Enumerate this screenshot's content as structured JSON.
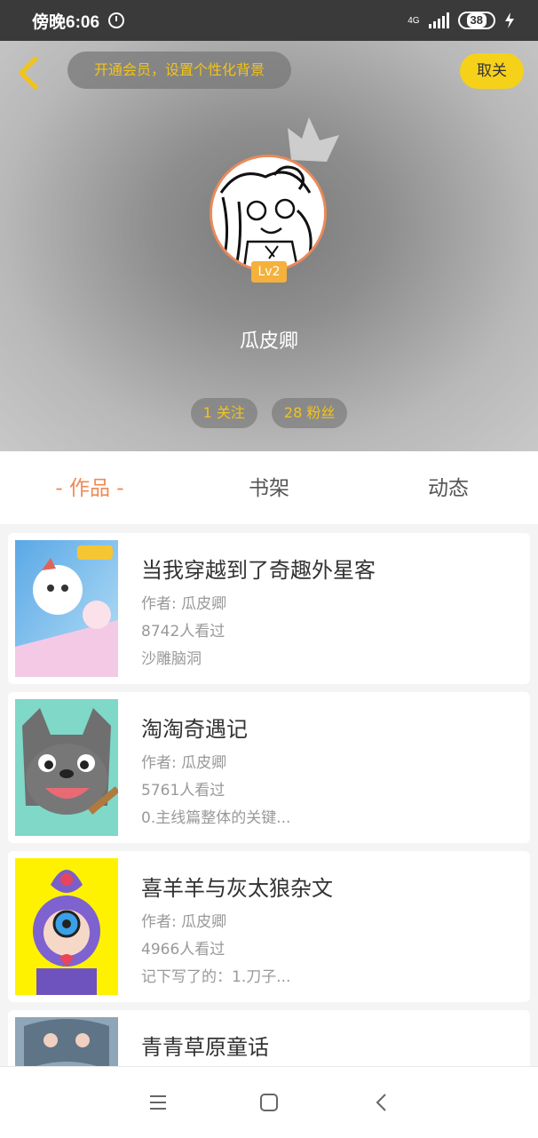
{
  "status_bar": {
    "time": "傍晚6:06",
    "network": "4G",
    "battery": "38"
  },
  "header": {
    "vip_prompt": "开通会员，设置个性化背景",
    "follow_button": "取关",
    "level_badge": "Lv2",
    "username": "瓜皮卿",
    "stats": {
      "following": "1 关注",
      "fans": "28 粉丝"
    }
  },
  "tabs": [
    {
      "label": "- 作品 -",
      "active": true
    },
    {
      "label": "书架",
      "active": false
    },
    {
      "label": "动态",
      "active": false
    }
  ],
  "works": [
    {
      "title": "当我穿越到了奇趣外星客",
      "author": "作者: 瓜皮卿",
      "views": "8742人看过",
      "desc": "沙雕脑洞"
    },
    {
      "title": "淘淘奇遇记",
      "author": "作者: 瓜皮卿",
      "views": "5761人看过",
      "desc": "0.主线篇整体的关键..."
    },
    {
      "title": "喜羊羊与灰太狼杂文",
      "author": "作者: 瓜皮卿",
      "views": "4966人看过",
      "desc": "记下写了的：1.刀子..."
    },
    {
      "title": "青青草原童话",
      "author": "",
      "views": "",
      "desc": ""
    }
  ],
  "colors": {
    "accent": "#ef8a54",
    "yellow": "#f6d11a",
    "badge": "#f4b13c"
  },
  "icons": [
    "back-arrow-icon",
    "alarm-icon",
    "crown-icon",
    "menu-icon",
    "home-icon",
    "back-nav-icon"
  ]
}
